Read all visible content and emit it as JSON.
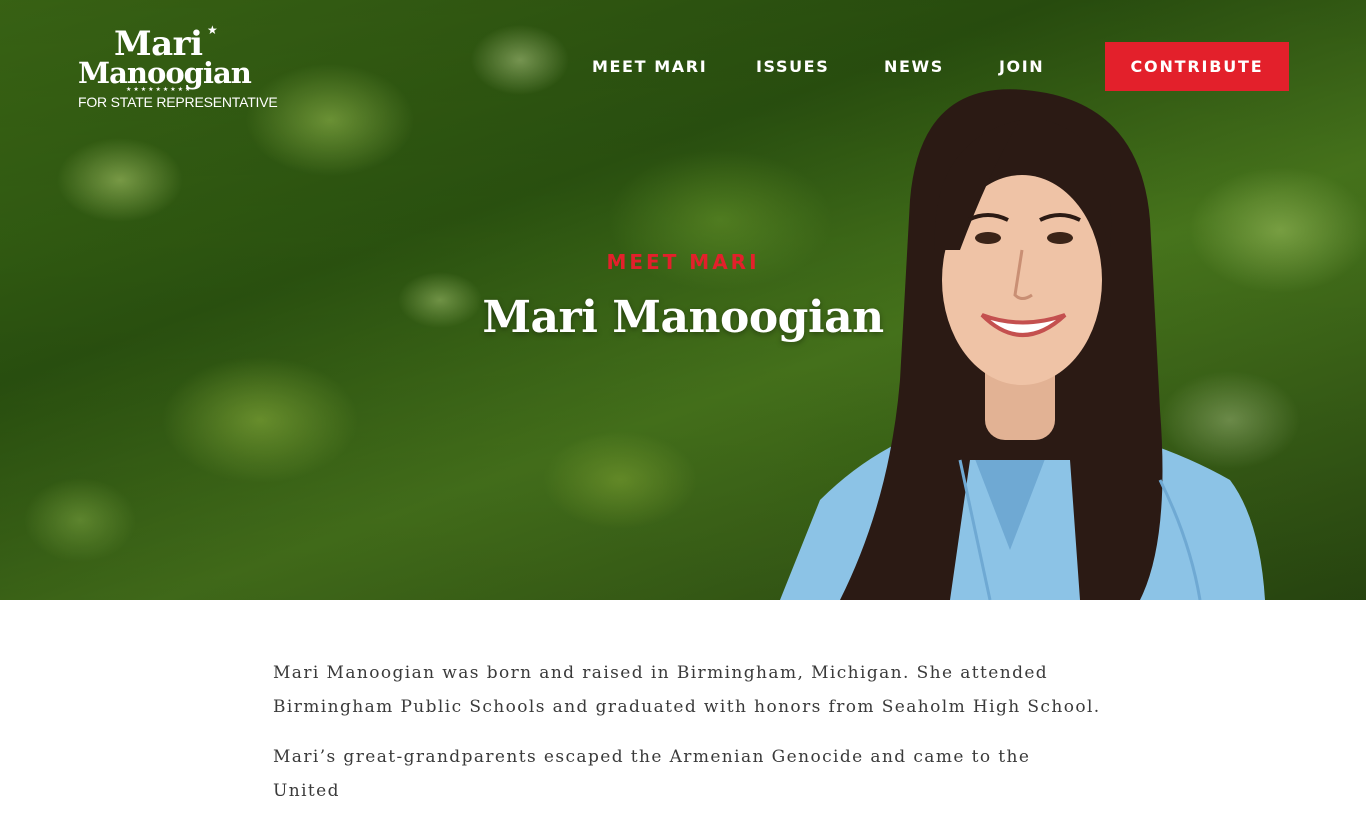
{
  "logo": {
    "line1": "Mari",
    "line2": "Manoogian",
    "stars": "★★★★★★★★★",
    "tagline": "FOR STATE REPRESENTATIVE"
  },
  "nav": {
    "items": [
      {
        "label": "MEET MARI"
      },
      {
        "label": "ISSUES"
      },
      {
        "label": "NEWS"
      },
      {
        "label": "JOIN"
      }
    ],
    "cta_label": "CONTRIBUTE"
  },
  "hero": {
    "kicker": "MEET MARI",
    "title": "Mari Manoogian"
  },
  "content": {
    "paragraphs": [
      "Mari Manoogian was born and raised in Birmingham, Michigan. She attended Birmingham Public Schools and graduated with honors from Seaholm High School.",
      "Mari’s great-grandparents escaped the Armenian Genocide and came to the United"
    ]
  },
  "colors": {
    "accent_red": "#e3202b",
    "text_dark": "#3a3a3a",
    "white": "#ffffff"
  }
}
